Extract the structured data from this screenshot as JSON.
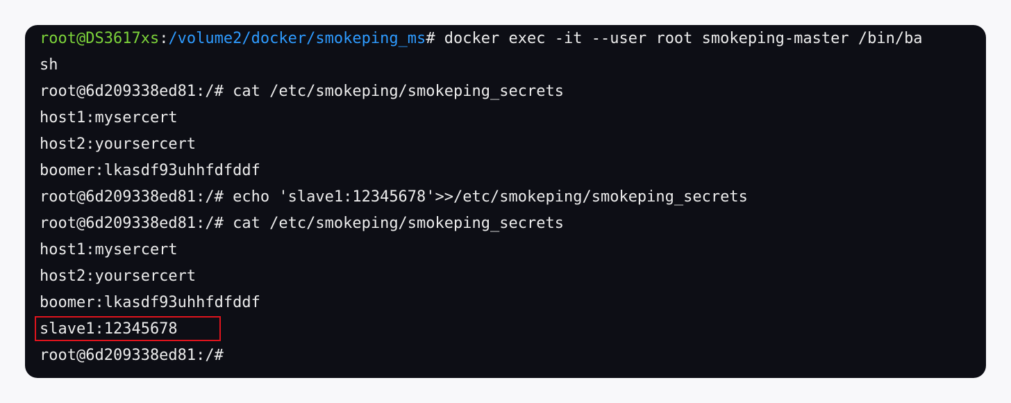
{
  "terminal": {
    "prompt_user_host": "root@DS3617xs",
    "prompt_sep": ":",
    "prompt_path": "/volume2/docker/smokeping_ms",
    "prompt_symbol": "#",
    "first_command": " docker exec -it --user root smokeping-master /bin/ba",
    "first_command_wrap": "sh",
    "lines": [
      "root@6d209338ed81:/# cat /etc/smokeping/smokeping_secrets",
      "host1:mysercert",
      "host2:yoursercert",
      "boomer:lkasdf93uhhfdfddf",
      "root@6d209338ed81:/# echo 'slave1:12345678'>>/etc/smokeping/smokeping_secrets",
      "root@6d209338ed81:/# cat /etc/smokeping/smokeping_secrets",
      "host1:mysercert",
      "host2:yoursercert",
      "boomer:lkasdf93uhhfdfddf",
      "slave1:12345678",
      "root@6d209338ed81:/#"
    ]
  },
  "colors": {
    "background": "#0d0e15",
    "text": "#ececec",
    "user_host": "#7cd33a",
    "path": "#2e9bff",
    "highlight": "#e0141d"
  }
}
